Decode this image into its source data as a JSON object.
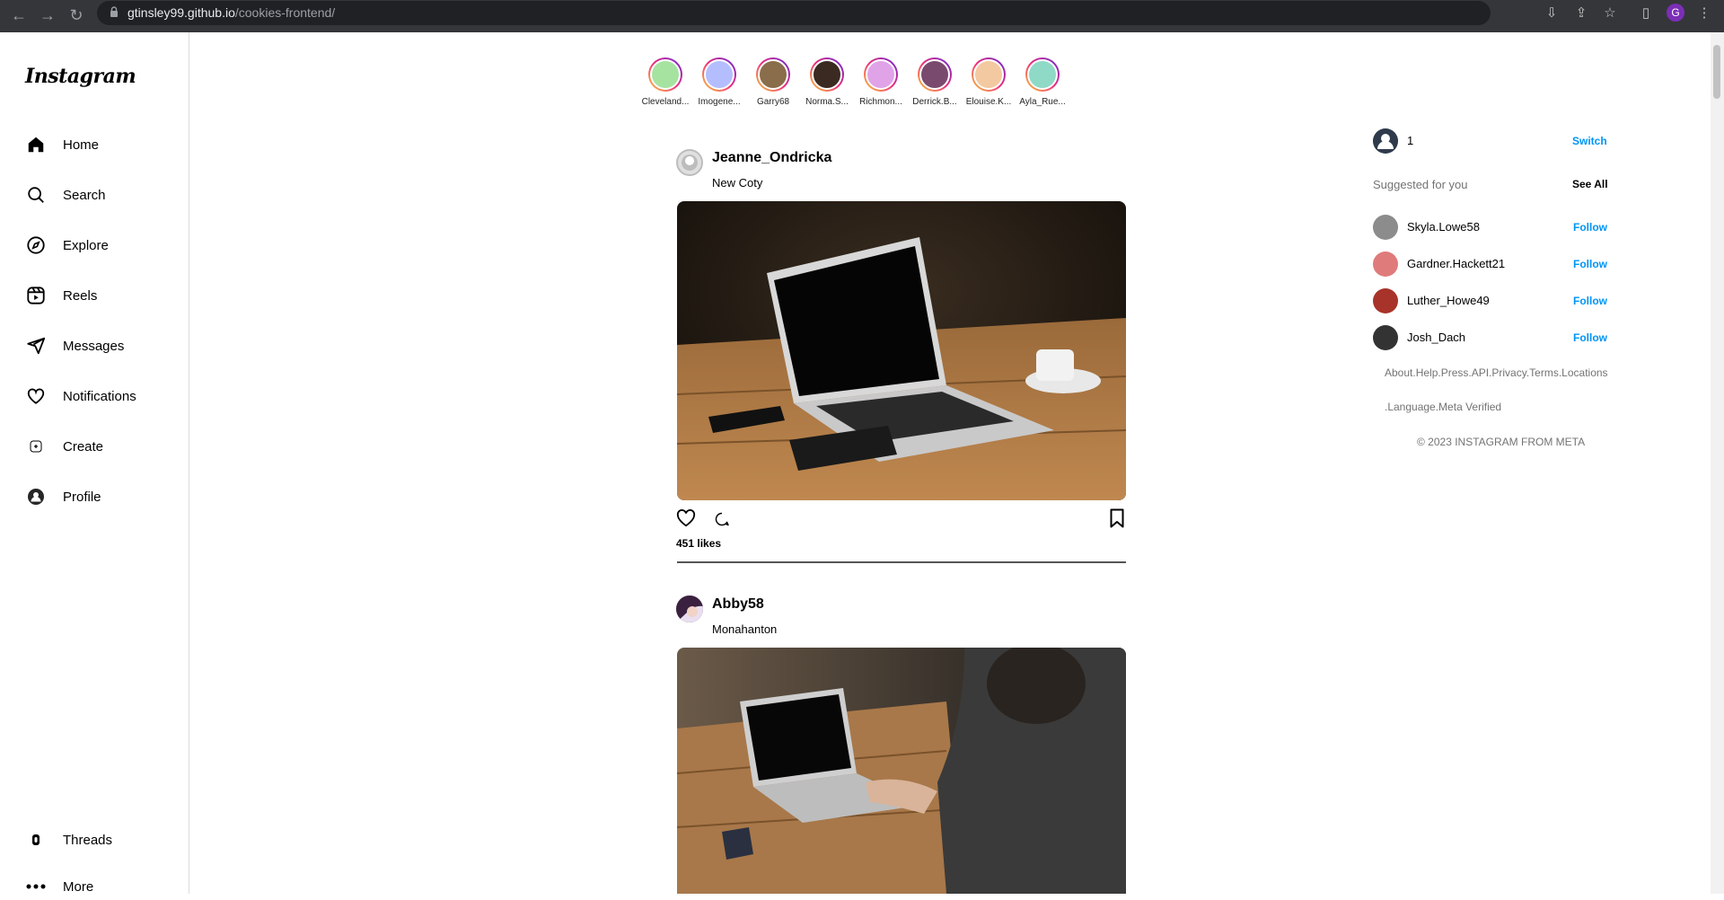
{
  "browser": {
    "url_host": "gtinsley99.github.io",
    "url_path": "/cookies-frontend/",
    "profile_initial": "G"
  },
  "sidebar": {
    "logo": "Instagram",
    "items": [
      {
        "label": "Home",
        "icon": "home-icon"
      },
      {
        "label": "Search",
        "icon": "search-icon"
      },
      {
        "label": "Explore",
        "icon": "compass-icon"
      },
      {
        "label": "Reels",
        "icon": "reels-icon"
      },
      {
        "label": "Messages",
        "icon": "send-icon"
      },
      {
        "label": "Notifications",
        "icon": "heart-icon"
      },
      {
        "label": "Create",
        "icon": "plus-square-icon"
      },
      {
        "label": "Profile",
        "icon": "profile-icon"
      }
    ],
    "bottom_items": [
      {
        "label": "Threads",
        "icon": "threads-icon"
      },
      {
        "label": "More",
        "icon": "more-icon"
      }
    ]
  },
  "stories": [
    {
      "name": "Cleveland...",
      "color": "#a6e3a1"
    },
    {
      "name": "Imogene...",
      "color": "#b4befe"
    },
    {
      "name": "Garry68",
      "color": "#8a6d4a"
    },
    {
      "name": "Norma.S...",
      "color": "#3b2a22"
    },
    {
      "name": "Richmon...",
      "color": "#e0a3e8"
    },
    {
      "name": "Derrick.B...",
      "color": "#7a4a6e"
    },
    {
      "name": "Elouise.K...",
      "color": "#f2c9a0"
    },
    {
      "name": "Ayla_Rue...",
      "color": "#8fd9c7"
    }
  ],
  "posts": [
    {
      "user": "Jeanne_Ondricka",
      "location": "New Coty",
      "likes": "451 likes"
    },
    {
      "user": "Abby58",
      "location": "Monahanton"
    }
  ],
  "rail": {
    "current_user": "1",
    "switch_label": "Switch",
    "suggested_title": "Suggested for you",
    "see_all": "See All",
    "suggestions": [
      {
        "name": "Skyla.Lowe58",
        "action": "Follow",
        "color": "#8c8c8c"
      },
      {
        "name": "Gardner.Hackett21",
        "action": "Follow",
        "color": "#e07b7b"
      },
      {
        "name": "Luther_Howe49",
        "action": "Follow",
        "color": "#a8332a"
      },
      {
        "name": "Josh_Dach",
        "action": "Follow",
        "color": "#333333"
      }
    ],
    "footer_line1": "About.Help.Press.API.Privacy.Terms.Locations",
    "footer_line2": ".Language.Meta Verified",
    "copyright": "© 2023 INSTAGRAM FROM META"
  }
}
